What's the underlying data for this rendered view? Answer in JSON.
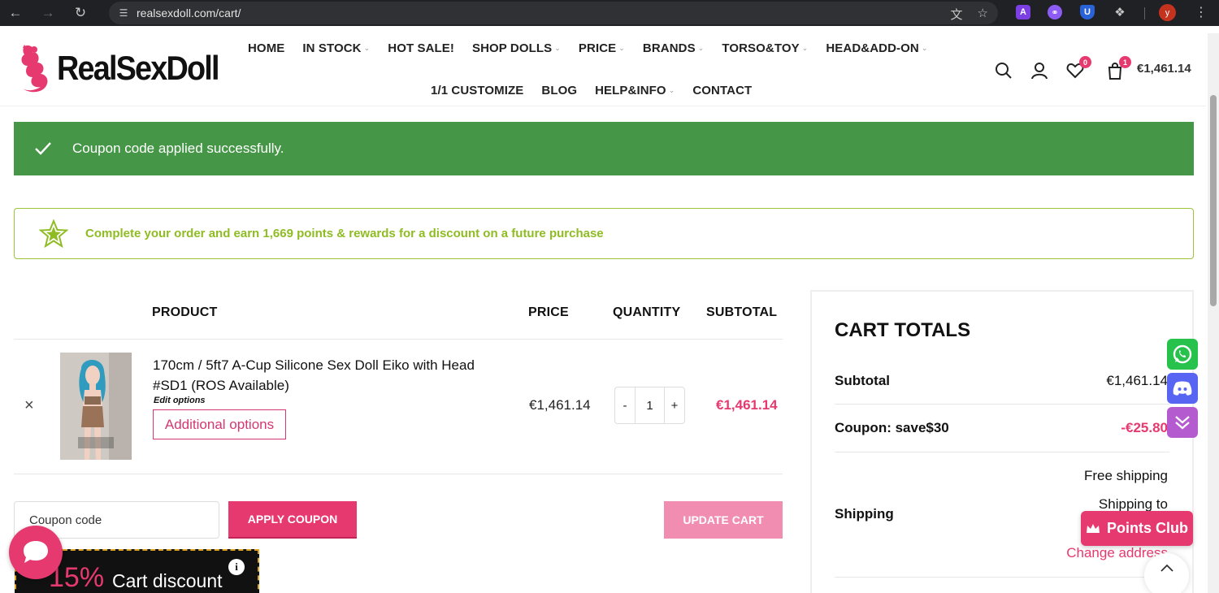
{
  "browser": {
    "url": "realsexdoll.com/cart/",
    "profile_initial": "y",
    "ext_a_label": "A",
    "ext_u_label": "U"
  },
  "header": {
    "logo_text": "RealSexDoll",
    "nav_row1": [
      "HOME",
      "IN STOCK",
      "HOT SALE!",
      "SHOP DOLLS",
      "PRICE",
      "BRANDS",
      "TORSO&TOY",
      "HEAD&ADD-ON"
    ],
    "nav_row2": [
      "1/1 CUSTOMIZE",
      "BLOG",
      "HELP&INFO",
      "CONTACT"
    ],
    "wishlist_count": "0",
    "cart_count": "1",
    "cart_total": "€1,461.14"
  },
  "notices": {
    "success": "Coupon code applied successfully.",
    "points": "Complete your order and earn 1,669 points & rewards for a discount on a future purchase"
  },
  "cart_table": {
    "headers": {
      "product": "PRODUCT",
      "price": "PRICE",
      "quantity": "QUANTITY",
      "subtotal": "SUBTOTAL"
    },
    "item": {
      "remove": "×",
      "name": "170cm / 5ft7 A-Cup Silicone Sex Doll Eiko with Head #SD1 (ROS Available)",
      "edit_options": "Edit options",
      "additional_options": "Additional options",
      "price": "€1,461.14",
      "qty_minus": "-",
      "qty": "1",
      "qty_plus": "+",
      "subtotal": "€1,461.14"
    },
    "coupon_placeholder": "Coupon code",
    "apply_coupon": "APPLY COUPON",
    "update_cart": "UPDATE CART"
  },
  "promo": {
    "percent": "15%",
    "label": "Cart discount",
    "info": "i"
  },
  "totals": {
    "title": "CART TOTALS",
    "subtotal_label": "Subtotal",
    "subtotal_value": "€1,461.14",
    "coupon_label": "Coupon: save$30",
    "coupon_value": "-€25.80",
    "shipping_label": "Shipping",
    "shipping_method": "Free shipping",
    "shipping_to": "Shipping to",
    "change_address": "Change address"
  },
  "floating": {
    "points_club": "Points Club"
  },
  "colors": {
    "brand_pink": "#e6396f",
    "success_green": "#459647",
    "points_green": "#8fbc23"
  }
}
